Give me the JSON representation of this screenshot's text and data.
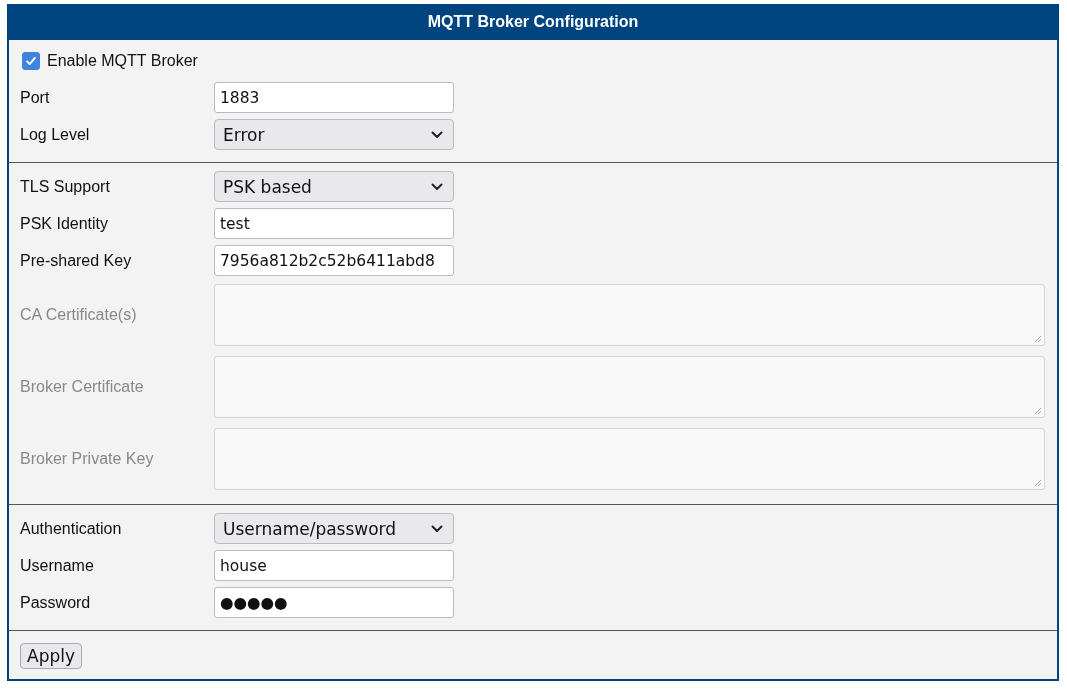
{
  "title": "MQTT Broker Configuration",
  "sections": [
    {
      "rows": [
        {
          "kind": "checkbox",
          "label": "Enable MQTT Broker",
          "checked": true
        },
        {
          "kind": "text",
          "label": "Port",
          "value": "1883"
        },
        {
          "kind": "select",
          "label": "Log Level",
          "value": "Error"
        }
      ]
    },
    {
      "rows": [
        {
          "kind": "select",
          "label": "TLS Support",
          "value": "PSK based"
        },
        {
          "kind": "text",
          "label": "PSK Identity",
          "value": "test"
        },
        {
          "kind": "text",
          "label": "Pre-shared Key",
          "value": "7956a812b2c52b6411abd8"
        },
        {
          "kind": "textarea",
          "label": "CA Certificate(s)",
          "disabled": true
        },
        {
          "kind": "textarea",
          "label": "Broker Certificate",
          "disabled": true
        },
        {
          "kind": "textarea",
          "label": "Broker Private Key",
          "disabled": true
        }
      ]
    },
    {
      "rows": [
        {
          "kind": "select",
          "label": "Authentication",
          "value": "Username/password"
        },
        {
          "kind": "text",
          "label": "Username",
          "value": "house"
        },
        {
          "kind": "text",
          "label": "Password",
          "value": "●●●●●"
        }
      ]
    }
  ],
  "buttons": [
    "Apply"
  ]
}
